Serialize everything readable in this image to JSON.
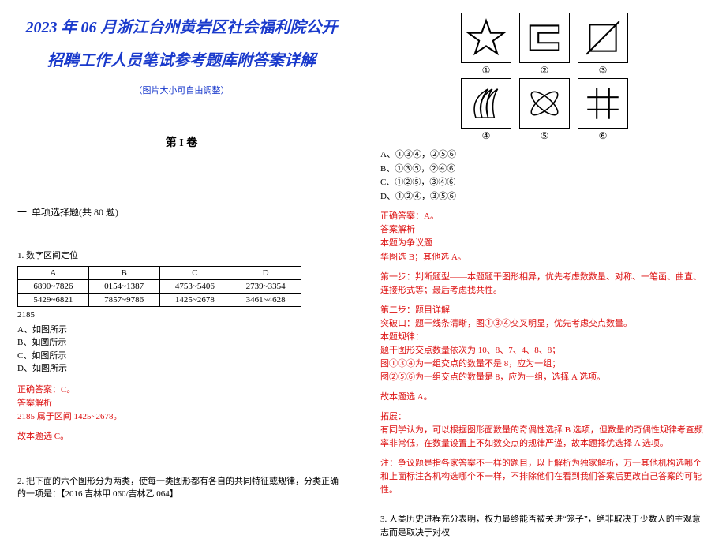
{
  "title_line1": "2023 年 06 月浙江台州黄岩区社会福利院公开",
  "title_line2": "招聘工作人员笔试参考题库附答案详解",
  "subtitle": "（图片大小可自由调整）",
  "volume_heading": "第 I 卷",
  "section_heading": "一. 单项选择题(共 80 题)",
  "q1": {
    "stem": "1. 数字区间定位",
    "table": {
      "headers": [
        "A",
        "B",
        "C",
        "D"
      ],
      "rows": [
        [
          "6890~7826",
          "0154~1387",
          "4753~5406",
          "2739~3354"
        ],
        [
          "5429~6821",
          "7857~9786",
          "1425~2678",
          "3461~4628"
        ]
      ]
    },
    "target": "2185",
    "opts": [
      "A、如图所示",
      "B、如图所示",
      "C、如图所示",
      "D、如图所示"
    ],
    "ans_correct": "正确答案：C。",
    "ans_label": "答案解析",
    "ans_detail": "2185 属于区间 1425~2678。",
    "ans_pick": "故本题选 C。"
  },
  "q2": {
    "stem": "2. 把下面的六个图形分为两类，使每一类图形都有各自的共同特征或规律，分类正确的一项是：【2016 吉林甲 060/吉林乙 064】",
    "circled": [
      "①",
      "②",
      "③",
      "④",
      "⑤",
      "⑥"
    ],
    "opts": [
      "A、①③④，②⑤⑥",
      "B、①③⑤，②④⑥",
      "C、①②⑤，③④⑥",
      "D、①②④，③⑤⑥"
    ],
    "ans_correct": "正确答案：A。",
    "ans_label": "答案解析",
    "ans_note1": "本题为争议题",
    "ans_note2": "华图选 B；其他选 A。",
    "step1": "第一步：判断题型——本题题干图形相异，优先考虑数数量、对称、一笔画、曲直、连接形式等；最后考虑找共性。",
    "step2_title": "第二步：题目详解",
    "step2_l1": "突破口：题干线条清晰，图①③④交叉明显，优先考虑交点数量。",
    "step2_l2": "本题规律：",
    "step2_l3": "题干图形交点数量依次为 10、8、7、4、8、8；",
    "step2_l4": "图①③④为一组交点的数量不是 8，应为一组；",
    "step2_l5": "图②⑤⑥为一组交点的数量是 8，应为一组，选择 A 选项。",
    "conclude": "故本题选 A。",
    "ext_label": "拓展：",
    "ext_body": "有同学认为，可以根据图形面数量的奇偶性选择 B 选项，但数量的奇偶性规律考查频率非常低，在数量设置上不如数交点的规律严谨，故本题择优选择 A 选项。",
    "note": "注：争议题是指各家答案不一样的题目，以上解析为独家解析，万一其他机构选哪个和上面标注各机构选哪个不一样，不排除他们在看到我们答案后更改自己答案的可能性。"
  },
  "q3": {
    "stem": "3. 人类历史进程充分表明，权力最终能否被关进“笼子”，绝非取决于少数人的主观意志而是取决于对权"
  }
}
